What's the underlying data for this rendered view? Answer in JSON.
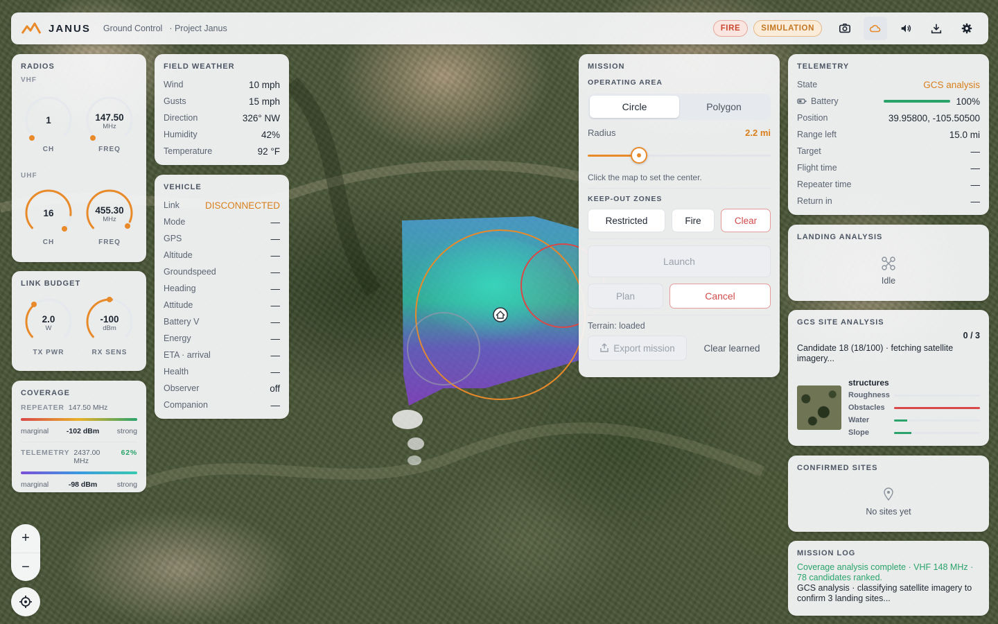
{
  "header": {
    "brand": "JANUS",
    "subtitle": "Ground Control",
    "project": "· Project Janus",
    "badge_fire": "FIRE",
    "badge_sim": "SIMULATION",
    "icons": [
      "camera-icon",
      "cloud-icon",
      "volume-icon",
      "download-icon",
      "gear-icon"
    ]
  },
  "radios": {
    "title": "RADIOS",
    "vhf_label": "VHF",
    "vhf_ch": "1",
    "vhf_freq": "147.50",
    "vhf_unit": "MHz",
    "ch_label": "CH",
    "freq_label": "FREQ",
    "uhf_label": "UHF",
    "uhf_ch": "16",
    "uhf_freq": "455.30",
    "uhf_unit": "MHz"
  },
  "link_budget": {
    "title": "LINK BUDGET",
    "tx_value": "2.0",
    "tx_unit": "W",
    "tx_label": "TX PWR",
    "rx_value": "-100",
    "rx_unit": "dBm",
    "rx_label": "RX SENS"
  },
  "coverage": {
    "title": "COVERAGE",
    "repeater_label": "REPEATER",
    "repeater_freq": "147.50 MHz",
    "rep_low": "marginal",
    "rep_value": "-102 dBm",
    "rep_high": "strong",
    "telemetry_label": "TELEMETRY",
    "telemetry_freq": "2437.00 MHz",
    "telemetry_pct": "62%",
    "tel_low": "marginal",
    "tel_value": "-98 dBm",
    "tel_high": "strong"
  },
  "weather": {
    "title": "FIELD WEATHER",
    "rows": [
      {
        "k": "Wind",
        "v": "10 mph"
      },
      {
        "k": "Gusts",
        "v": "15 mph"
      },
      {
        "k": "Direction",
        "v": "326° NW"
      },
      {
        "k": "Humidity",
        "v": "42%"
      },
      {
        "k": "Temperature",
        "v": "92 °F"
      }
    ]
  },
  "vehicle": {
    "title": "VEHICLE",
    "rows": [
      {
        "k": "Link",
        "v": "DISCONNECTED"
      },
      {
        "k": "Mode",
        "v": "—"
      },
      {
        "k": "GPS",
        "v": "—"
      },
      {
        "k": "Altitude",
        "v": "—"
      },
      {
        "k": "Groundspeed",
        "v": "—"
      },
      {
        "k": "Heading",
        "v": "—"
      },
      {
        "k": "Attitude",
        "v": "—"
      },
      {
        "k": "Battery V",
        "v": "—"
      },
      {
        "k": "Energy",
        "v": "—"
      },
      {
        "k": "ETA · arrival",
        "v": "—"
      },
      {
        "k": "Health",
        "v": "—"
      },
      {
        "k": "Observer",
        "v": "off"
      },
      {
        "k": "Companion",
        "v": "—"
      }
    ]
  },
  "mission": {
    "title": "MISSION",
    "area_title": "OPERATING AREA",
    "seg_circle": "Circle",
    "seg_polygon": "Polygon",
    "radius_label": "Radius",
    "radius_value": "2.2 mi",
    "radius_fraction": 0.28,
    "hint": "Click the map to set the center.",
    "keepout_title": "KEEP-OUT ZONES",
    "btn_restricted": "Restricted",
    "btn_fire": "Fire",
    "btn_clear": "Clear",
    "btn_launch": "Launch",
    "btn_plan": "Plan",
    "btn_cancel": "Cancel",
    "terrain": "Terrain: loaded",
    "btn_export": "Export mission",
    "btn_clear_learned": "Clear learned"
  },
  "telemetry": {
    "title": "TELEMETRY",
    "rows": [
      {
        "k": "State",
        "v": "GCS analysis"
      },
      {
        "k": "Battery",
        "v": "100%"
      },
      {
        "k": "Position",
        "v": "39.95800, -105.50500"
      },
      {
        "k": "Range left",
        "v": "15.0 mi"
      },
      {
        "k": "Target",
        "v": "—"
      },
      {
        "k": "Flight time",
        "v": "—"
      },
      {
        "k": "Repeater time",
        "v": "—"
      },
      {
        "k": "Return in",
        "v": "—"
      }
    ],
    "battery_fraction": 1.0
  },
  "landing": {
    "title": "LANDING ANALYSIS",
    "status": "Idle"
  },
  "gcs_site": {
    "title": "GCS SITE ANALYSIS",
    "count": "0 / 3",
    "status": "Candidate 18 (18/100) · fetching satellite imagery...",
    "label": "structures",
    "metrics": [
      {
        "k": "Roughness",
        "v": 0.0,
        "color": "#2aa36b"
      },
      {
        "k": "Obstacles",
        "v": 1.0,
        "color": "#d94848"
      },
      {
        "k": "Water",
        "v": 0.15,
        "color": "#2aa36b"
      },
      {
        "k": "Slope",
        "v": 0.2,
        "color": "#2aa36b"
      }
    ]
  },
  "confirmed": {
    "title": "CONFIRMED SITES",
    "empty": "No sites yet"
  },
  "log": {
    "title": "MISSION LOG",
    "line1": "Coverage analysis complete · VHF 148 MHz · 78 candidates ranked.",
    "line2": "GCS analysis · classifying satellite imagery to confirm 3 landing sites..."
  },
  "map_controls": {
    "zoom_in": "+",
    "zoom_out": "−"
  },
  "colors": {
    "accent": "#e88a2a",
    "danger": "#d94848",
    "success": "#2aa36b"
  }
}
